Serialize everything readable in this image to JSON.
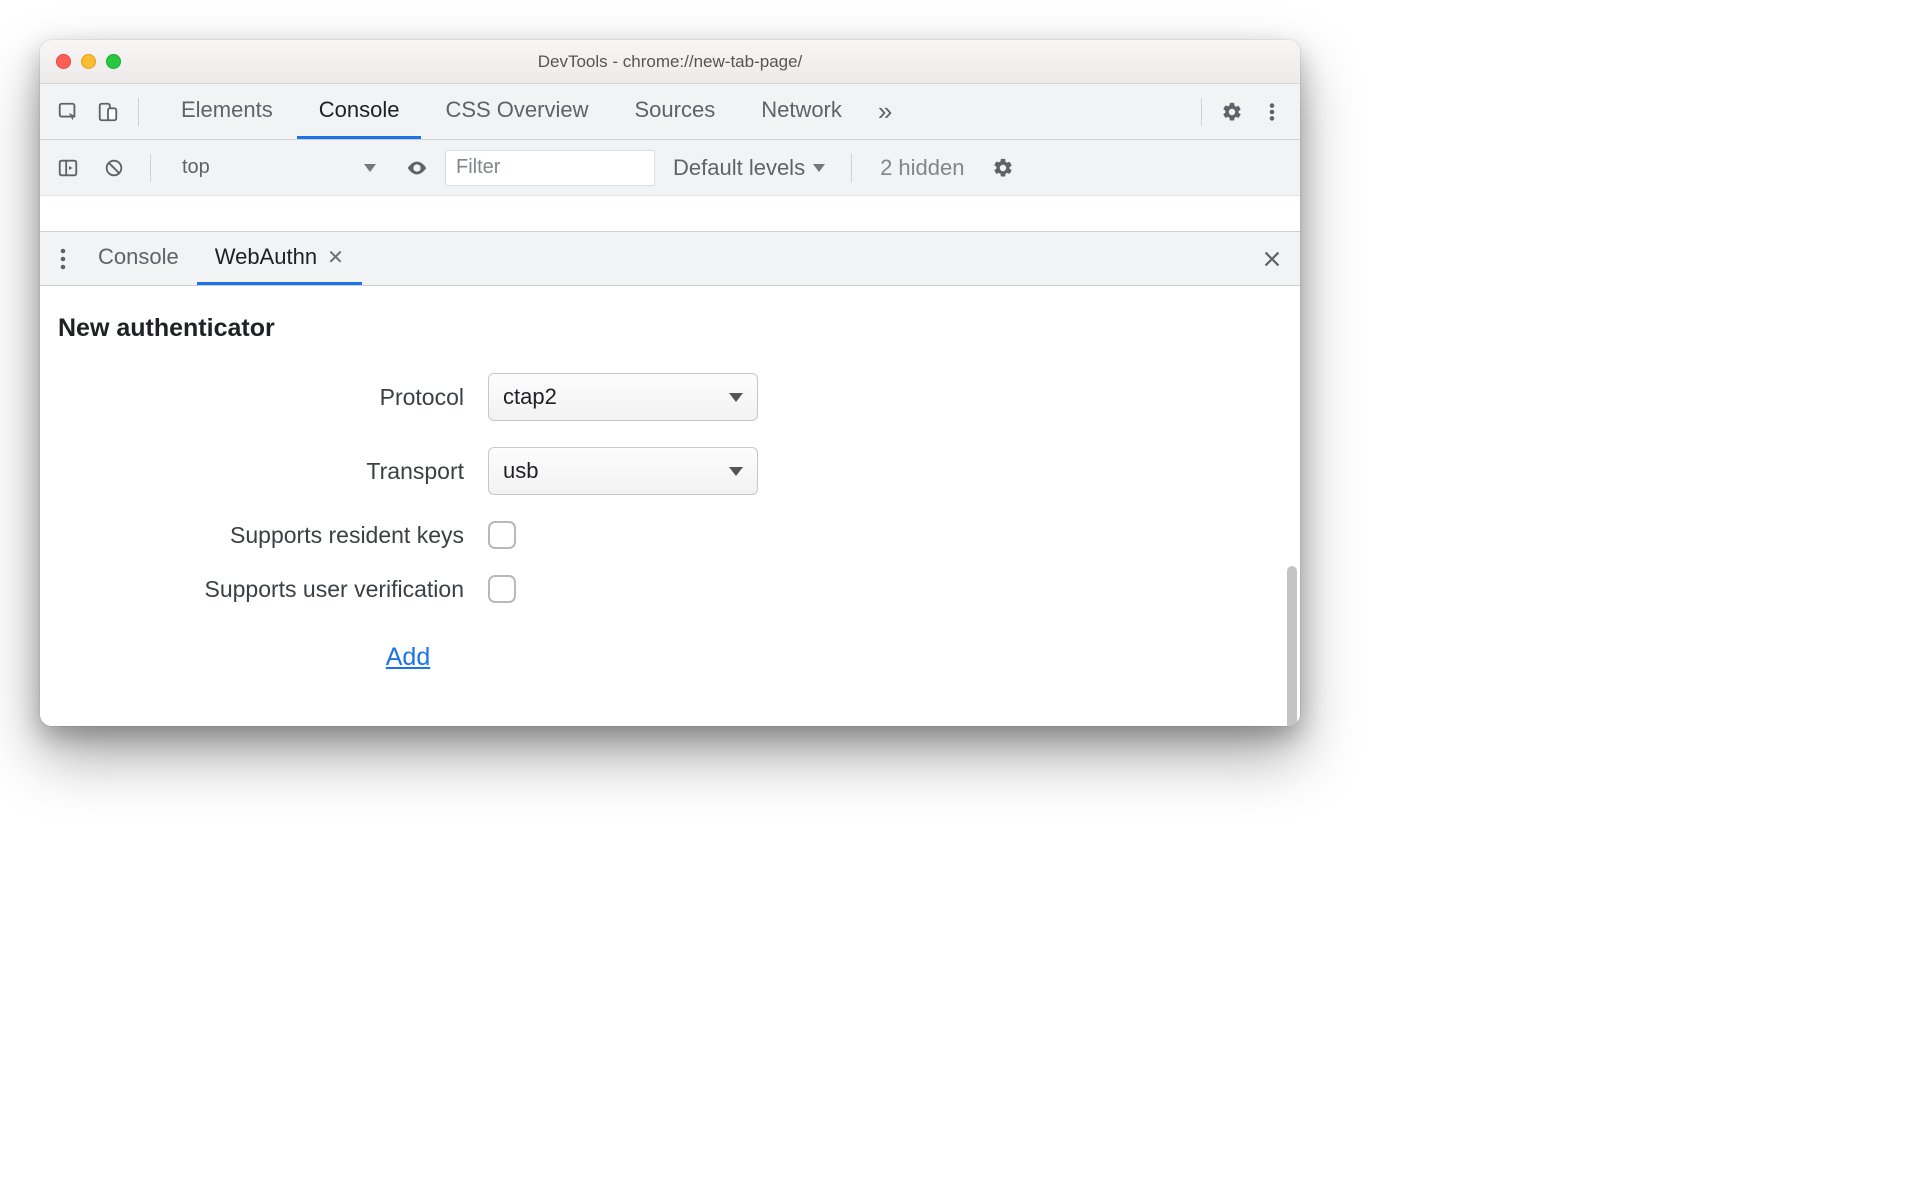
{
  "window": {
    "title": "DevTools - chrome://new-tab-page/"
  },
  "mainTabs": {
    "items": [
      "Elements",
      "Console",
      "CSS Overview",
      "Sources",
      "Network"
    ],
    "activeIndex": 1
  },
  "consoleToolbar": {
    "context": "top",
    "filterPlaceholder": "Filter",
    "levelsLabel": "Default levels",
    "hiddenCount": "2 hidden"
  },
  "drawerTabs": {
    "items": [
      {
        "label": "Console",
        "closeable": false
      },
      {
        "label": "WebAuthn",
        "closeable": true
      }
    ],
    "activeIndex": 1
  },
  "webauthn": {
    "sectionTitle": "New authenticator",
    "fields": {
      "protocol": {
        "label": "Protocol",
        "value": "ctap2"
      },
      "transport": {
        "label": "Transport",
        "value": "usb"
      },
      "residentKeys": {
        "label": "Supports resident keys",
        "checked": false
      },
      "userVerification": {
        "label": "Supports user verification",
        "checked": false
      }
    },
    "addLabel": "Add"
  }
}
